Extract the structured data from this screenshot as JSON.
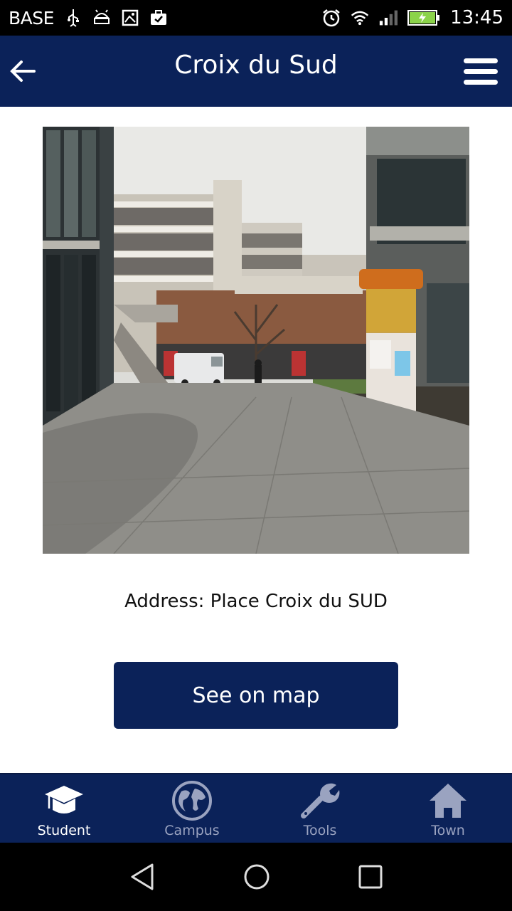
{
  "status_bar": {
    "carrier": "BASE",
    "time": "13:45",
    "icons": [
      "usb-icon",
      "android-debug-icon",
      "image-icon",
      "briefcase-icon",
      "alarm-icon",
      "wifi-icon",
      "signal-icon",
      "battery-charging-icon"
    ]
  },
  "header": {
    "title": "Croix du Sud",
    "back_icon": "arrow-left-icon",
    "menu_icon": "hamburger-menu-icon"
  },
  "main": {
    "photo_icon": "building-photo",
    "address": "Address: Place Croix du SUD",
    "map_button_label": "See on map"
  },
  "tabs": [
    {
      "label": "Student",
      "icon": "graduation-cap-icon",
      "active": true
    },
    {
      "label": "Campus",
      "icon": "globe-icon",
      "active": false
    },
    {
      "label": "Tools",
      "icon": "wrench-icon",
      "active": false
    },
    {
      "label": "Town",
      "icon": "home-icon",
      "active": false
    }
  ],
  "colors": {
    "primary": "#0b2259",
    "inactive_tab": "#9aa3c0"
  },
  "nav_bar": {
    "icons": [
      "back-triangle-icon",
      "home-circle-icon",
      "recents-square-icon"
    ]
  }
}
